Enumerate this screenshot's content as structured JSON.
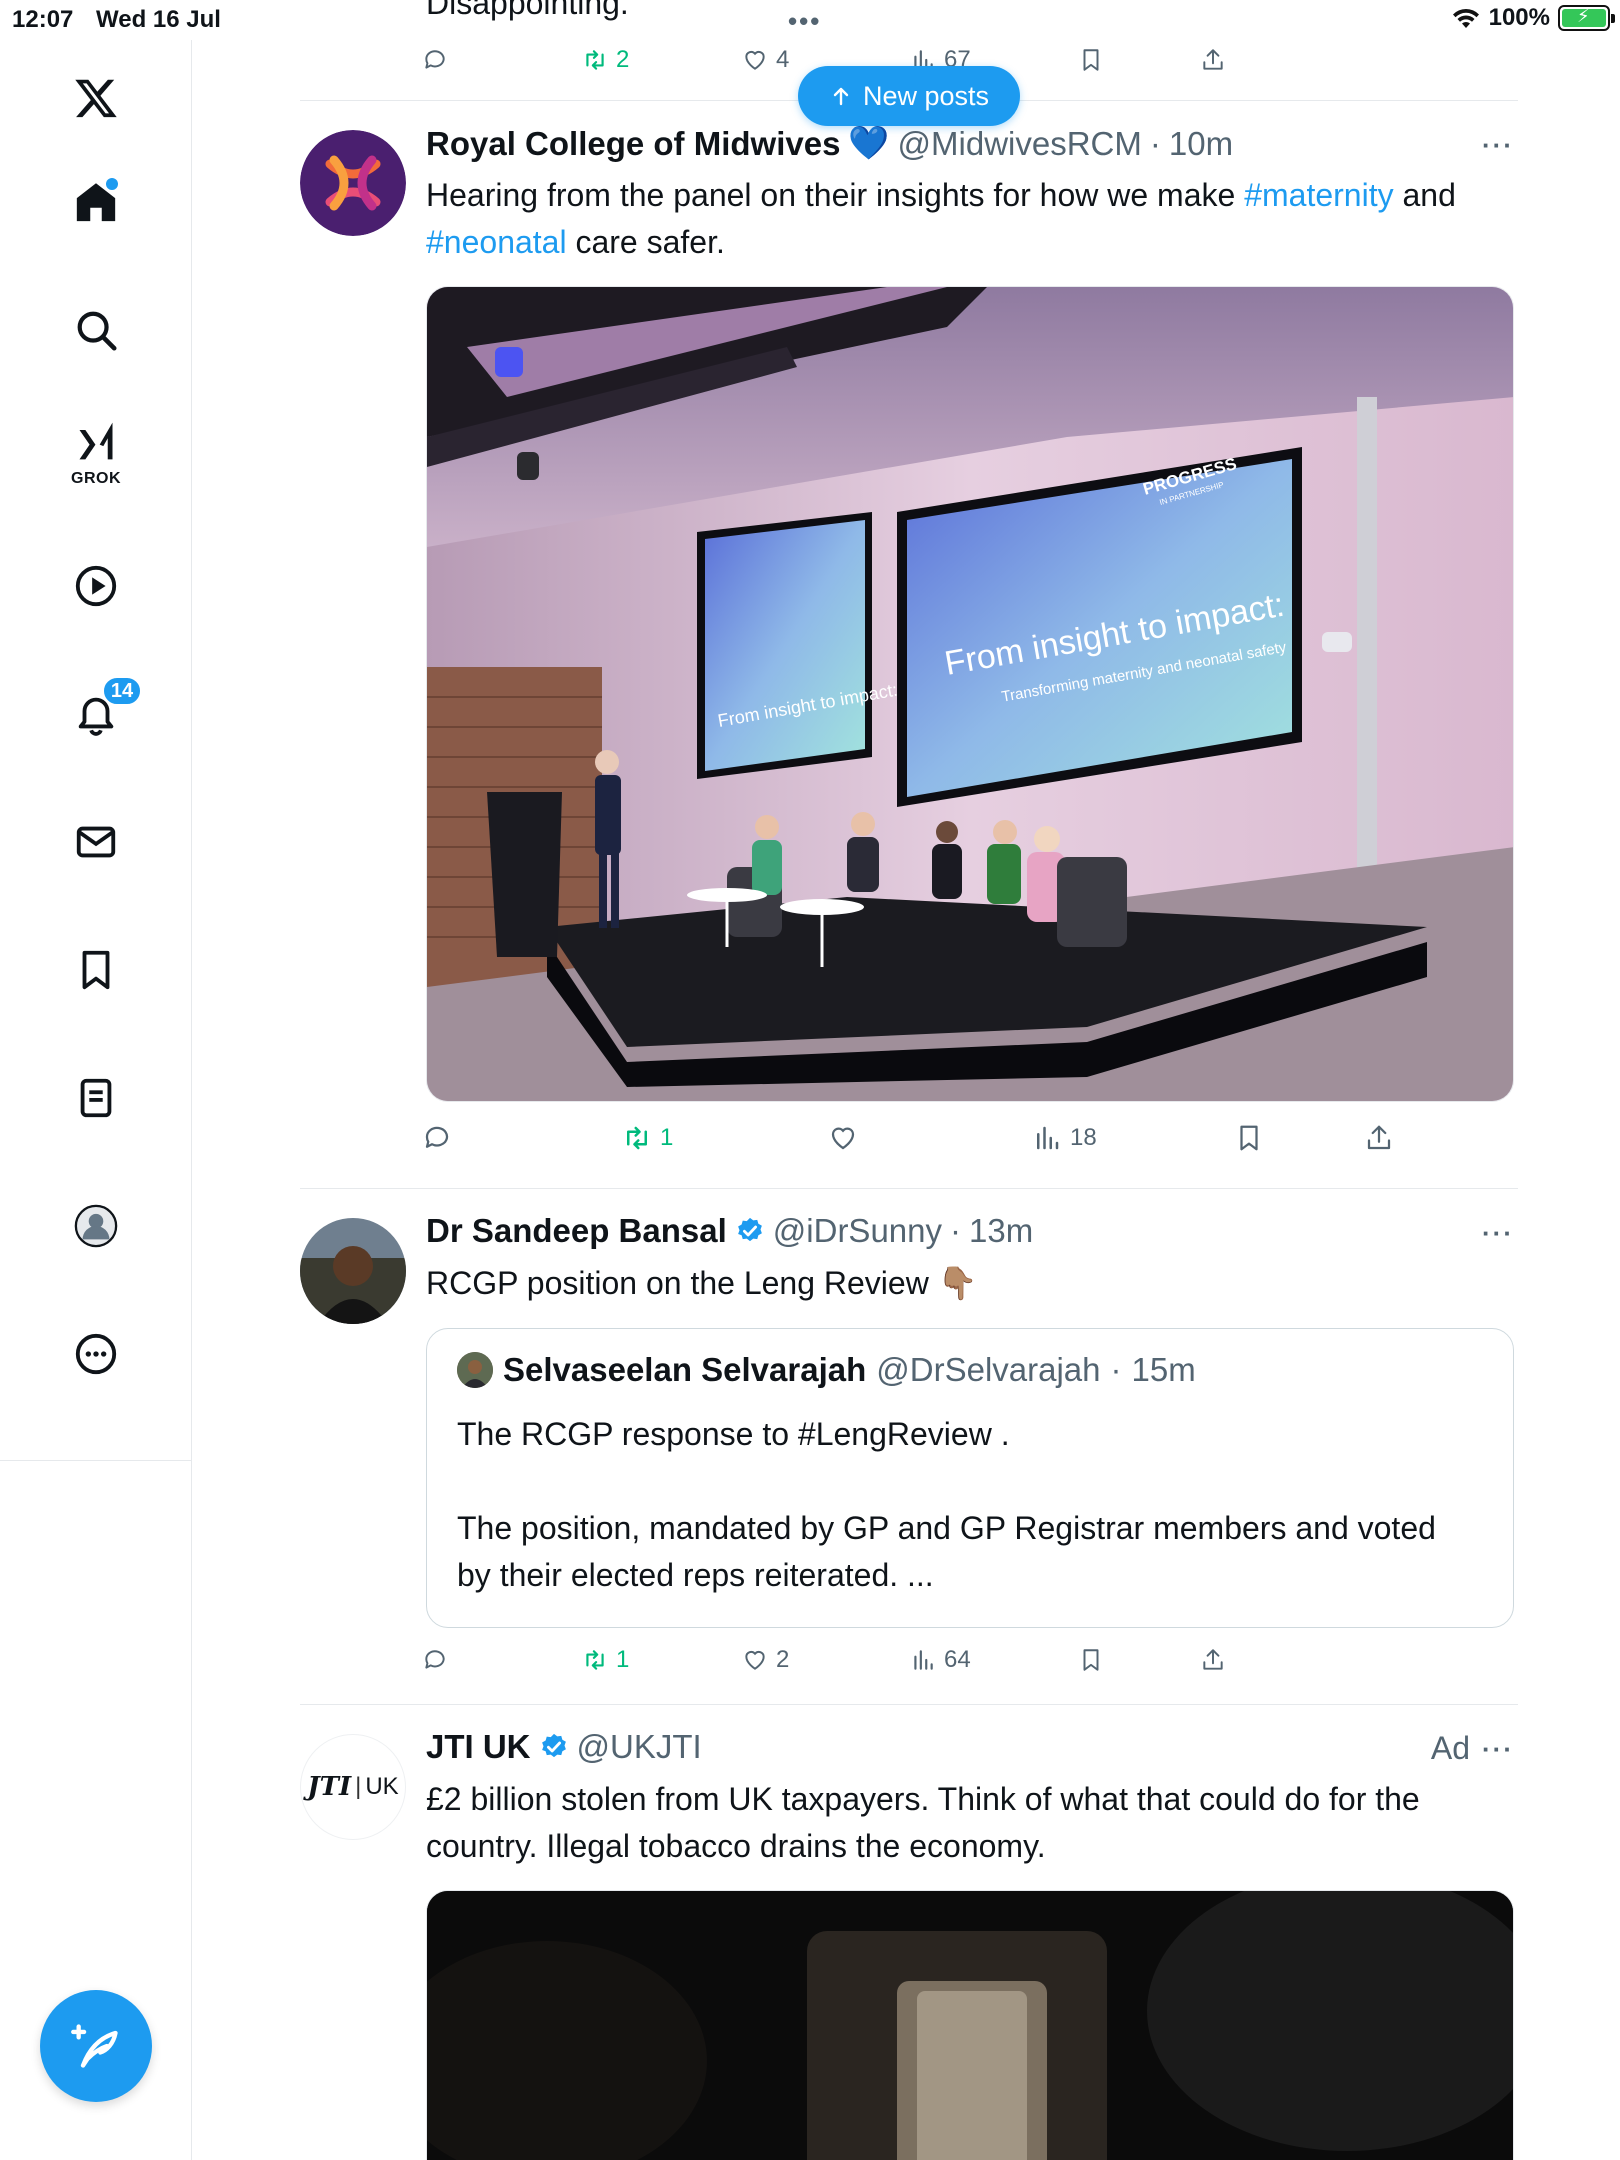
{
  "status_bar": {
    "time": "12:07",
    "date": "Wed 16 Jul",
    "battery": "100%",
    "dots": "•••"
  },
  "nav": {
    "grok_label": "GROK",
    "notifications_count": "14"
  },
  "colors": {
    "accent": "#1d9bf0",
    "repost_green": "#00ba7c",
    "muted": "#536471"
  },
  "top_partial": {
    "text": "Disappointing.",
    "reposts": "2",
    "likes": "4",
    "views": "67"
  },
  "new_posts": {
    "label": "New posts"
  },
  "posts": [
    {
      "name": "Royal College of Midwives",
      "badge": "💙",
      "handle": "@MidwivesRCM",
      "time": "10m",
      "text_1": "Hearing from the panel on their insights for how we make ",
      "hashtag_1": "#maternity",
      "text_2": " and ",
      "hashtag_2": "#neonatal",
      "text_3": " care safer.",
      "media": {
        "screen_title": "From insight to impact:",
        "screen_subtitle": "Transforming maternity and neonatal safety",
        "screen_logo": "PROGRESS",
        "screen_logo_sub": "IN PARTNERSHIP"
      },
      "reposts": "1",
      "likes": "",
      "views": "18"
    },
    {
      "name": "Dr Sandeep Bansal",
      "handle": "@iDrSunny",
      "time": "13m",
      "text": "RCGP position on the Leng Review",
      "emoji": "👇🏽",
      "quote": {
        "name": "Selvaseelan Selvarajah",
        "handle": "@DrSelvarajah",
        "time": "15m",
        "line_1": "The RCGP response to #LengReview .",
        "line_2": "The position, mandated by GP and GP Registrar  members and voted by their elected reps reiterated. ..."
      },
      "reposts": "1",
      "likes": "2",
      "views": "64"
    },
    {
      "name": "JTI UK",
      "handle": "@UKJTI",
      "ad_label": "Ad",
      "logo_text": "JTI",
      "logo_sub": "UK",
      "text": "£2 billion stolen from UK taxpayers. Think of what that could do for the country. Illegal tobacco drains the economy."
    }
  ]
}
